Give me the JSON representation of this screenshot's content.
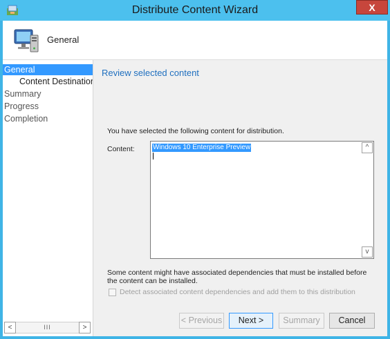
{
  "window": {
    "title": "Distribute Content Wizard",
    "close_label": "X"
  },
  "header": {
    "title": "General"
  },
  "sidebar": {
    "items": [
      {
        "label": "General",
        "active": true
      },
      {
        "label": "Content Destination",
        "sub": true
      },
      {
        "label": "Summary"
      },
      {
        "label": "Progress"
      },
      {
        "label": "Completion"
      }
    ],
    "scroll_left": "<",
    "scroll_right": ">",
    "scroll_thumb": "III"
  },
  "main": {
    "section_title": "Review selected content",
    "description": "You have selected the following content for distribution.",
    "content_label": "Content:",
    "content_value": "Windows 10 Enterprise Preview",
    "scroll_up": "^",
    "scroll_down": "v",
    "dependency_text": "Some content might have associated dependencies that must be installed before the content can be installed.",
    "checkbox_label": "Detect associated content dependencies and add them to this distribution",
    "checkbox_checked": false
  },
  "buttons": {
    "previous": "< Previous",
    "next": "Next >",
    "summary": "Summary",
    "cancel": "Cancel"
  }
}
